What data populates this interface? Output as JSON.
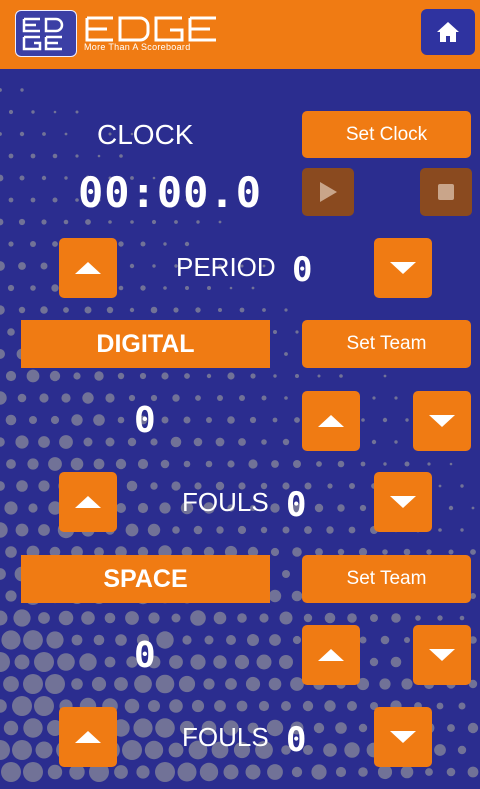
{
  "header": {
    "brand": "EDGE",
    "tagline": "More Than A Scoreboard",
    "home_icon": "home-icon"
  },
  "clock": {
    "label": "CLOCK",
    "set_label": "Set Clock",
    "time": "00:00.0",
    "play_icon": "play-icon",
    "stop_icon": "stop-icon"
  },
  "period": {
    "label": "PERIOD",
    "value": "0"
  },
  "teams": [
    {
      "name": "DIGITAL",
      "set_label": "Set Team",
      "score": "0",
      "fouls_label": "FOULS",
      "fouls": "0"
    },
    {
      "name": "SPACE",
      "set_label": "Set Team",
      "score": "0",
      "fouls_label": "FOULS",
      "fouls": "0"
    }
  ],
  "colors": {
    "background": "#2b2d8f",
    "accent": "#f07b13",
    "dots": "#8a8a9a"
  }
}
